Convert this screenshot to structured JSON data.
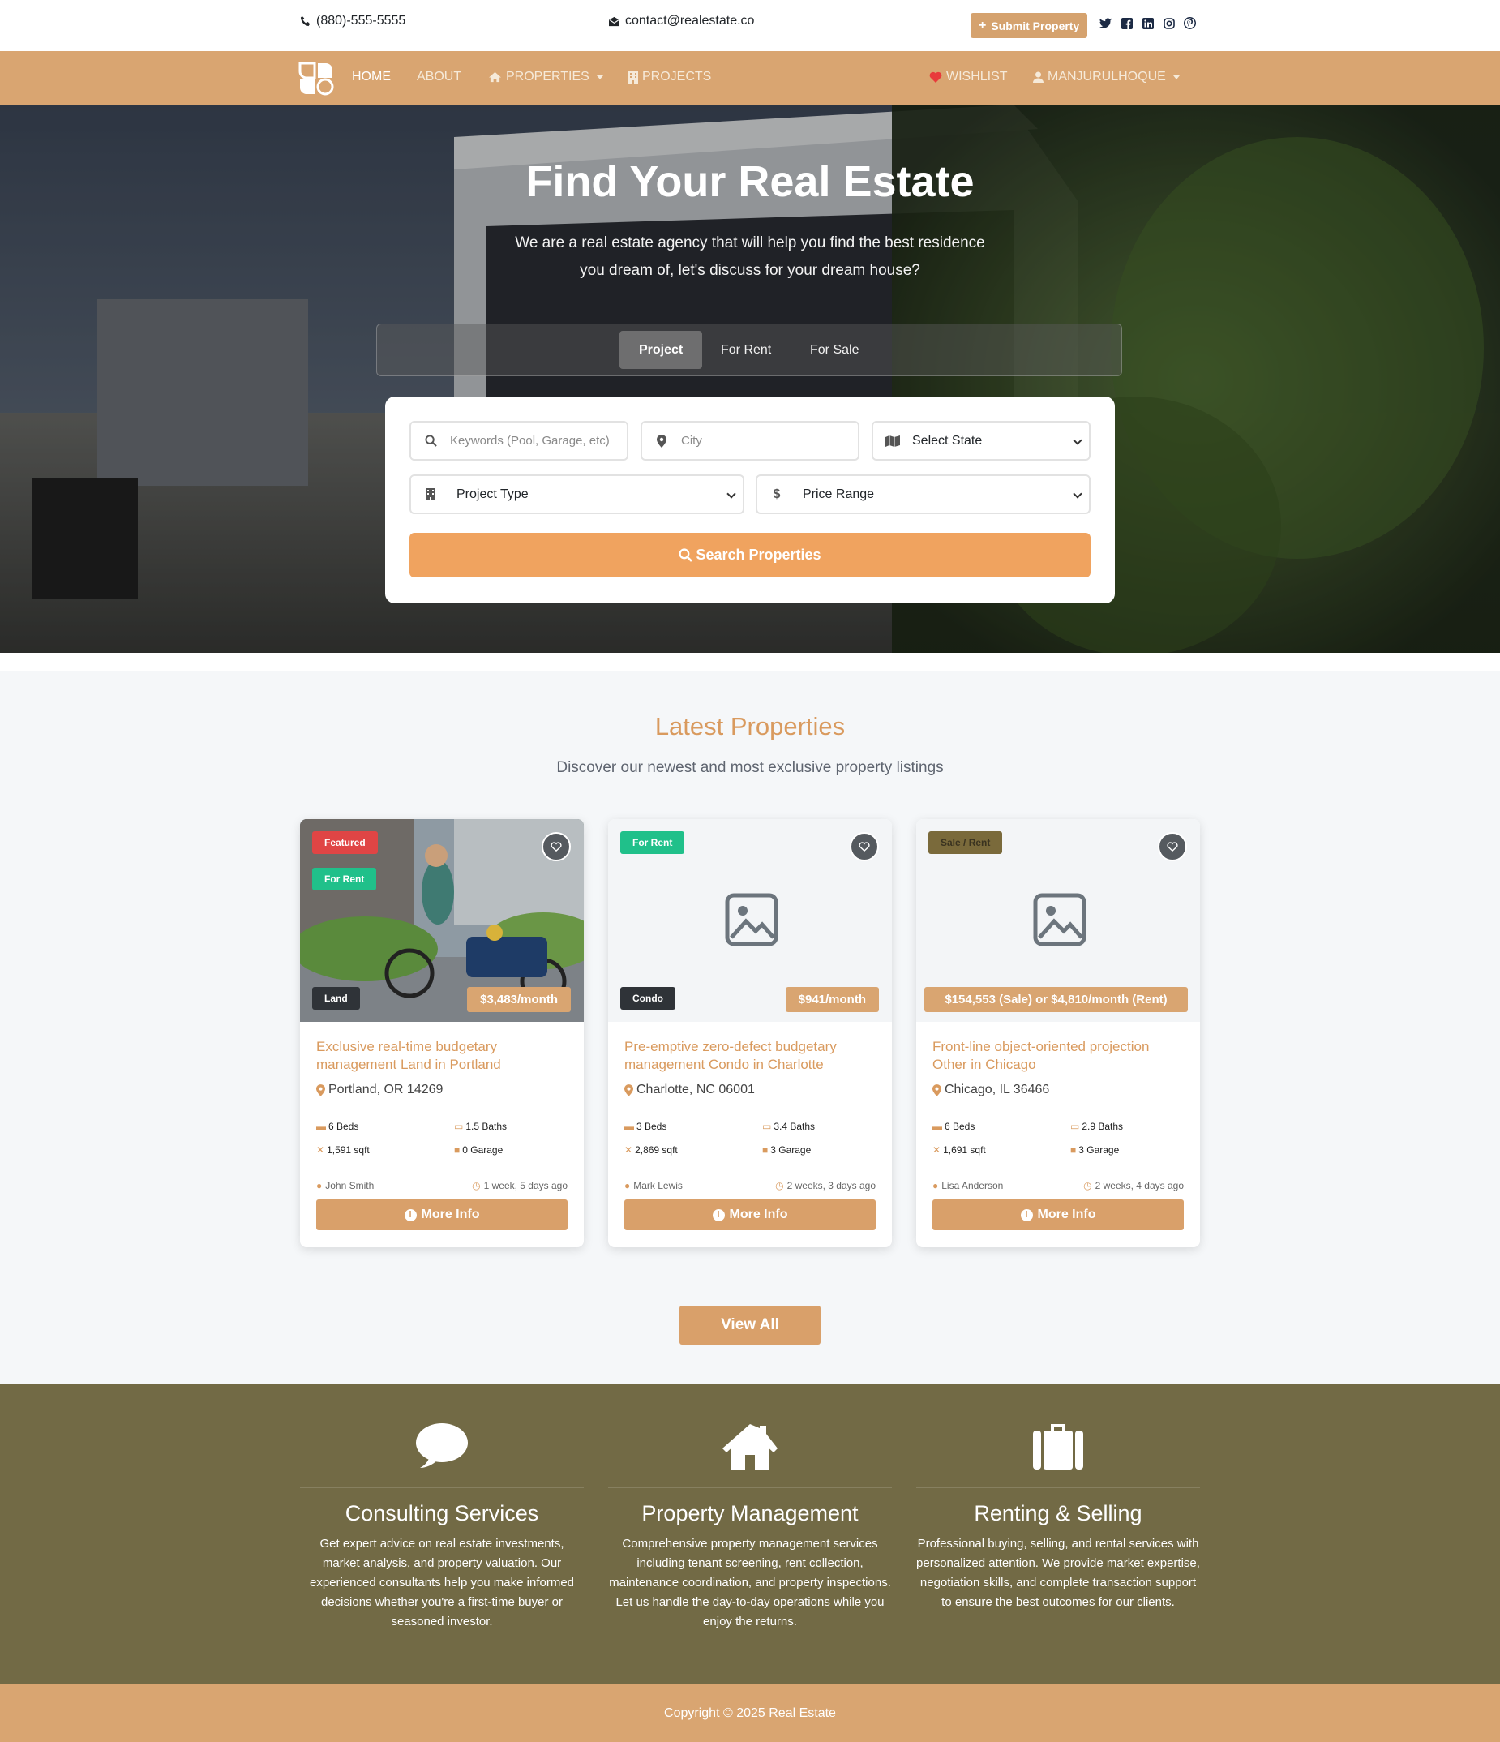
{
  "topbar": {
    "phone": "(880)-555-5555",
    "email": "contact@realestate.co",
    "submit_label": "Submit Property",
    "social": [
      "twitter-icon",
      "facebook-icon",
      "linkedin-icon",
      "instagram-icon",
      "pinterest-icon"
    ]
  },
  "nav": {
    "home": "HOME",
    "about": "ABOUT",
    "properties": "PROPERTIES",
    "projects": "PROJECTS",
    "wishlist": "WISHLIST",
    "user": "MANJURULHOQUE"
  },
  "hero": {
    "title": "Find Your Real Estate",
    "subtitle": "We are a real estate agency that will help you find the best residence you dream of, let's discuss for your dream house?",
    "tabs": [
      "Project",
      "For Rent",
      "For Sale"
    ],
    "active_tab": "Project"
  },
  "search": {
    "keywords_placeholder": "Keywords (Pool, Garage, etc)",
    "city_placeholder": "City",
    "state_selected": "Select State",
    "project_type_selected": "Project Type",
    "price_range_selected": "Price Range",
    "button_label": "Search Properties"
  },
  "latest": {
    "title": "Latest Properties",
    "subtitle": "Discover our newest and most exclusive property listings",
    "view_all": "View All",
    "cards": [
      {
        "badges": [
          "Featured",
          "For Rent"
        ],
        "type": "Land",
        "price": "$3,483/month",
        "title": "Exclusive real-time budgetary management Land in Portland",
        "location": "Portland, OR 14269",
        "beds": "6 Beds",
        "baths": "1.5 Baths",
        "sqft": "1,591 sqft",
        "garage": "0 Garage",
        "agent": "John Smith",
        "posted": "1 week, 5 days ago",
        "button": "More Info"
      },
      {
        "badges": [
          "For Rent"
        ],
        "type": "Condo",
        "price": "$941/month",
        "title": "Pre-emptive zero-defect budgetary management Condo in Charlotte",
        "location": "Charlotte, NC 06001",
        "beds": "3 Beds",
        "baths": "3.4 Baths",
        "sqft": "2,869 sqft",
        "garage": "3 Garage",
        "agent": "Mark Lewis",
        "posted": "2 weeks, 3 days ago",
        "button": "More Info"
      },
      {
        "badges": [
          "Sale / Rent"
        ],
        "type": "",
        "price": "$154,553 (Sale) or $4,810/month (Rent)",
        "title": "Front-line object-oriented projection Other in Chicago",
        "location": "Chicago, IL 36466",
        "beds": "6 Beds",
        "baths": "2.9 Baths",
        "sqft": "1,691 sqft",
        "garage": "3 Garage",
        "agent": "Lisa Anderson",
        "posted": "2 weeks, 4 days ago",
        "button": "More Info"
      }
    ]
  },
  "services": [
    {
      "icon": "comment-icon",
      "title": "Consulting Services",
      "text": "Get expert advice on real estate investments, market analysis, and property valuation. Our experienced consultants help you make informed decisions whether you're a first-time buyer or seasoned investor."
    },
    {
      "icon": "house-icon",
      "title": "Property Management",
      "text": "Comprehensive property management services including tenant screening, rent collection, maintenance coordination, and property inspections. Let us handle the day-to-day operations while you enjoy the returns."
    },
    {
      "icon": "suitcase-icon",
      "title": "Renting & Selling",
      "text": "Professional buying, selling, and rental services with personalized attention. We provide market expertise, negotiation skills, and complete transaction support to ensure the best outcomes for our clients."
    }
  ],
  "footer": {
    "copyright": "Copyright © 2025 Real Estate"
  },
  "colors": {
    "accent": "#d9a571",
    "search_button": "#f0a35f",
    "services_bg": "#726a45",
    "badge_featured": "#e04545",
    "badge_rent": "#20c08a",
    "badge_sale_rent": "#7a6a3b"
  }
}
